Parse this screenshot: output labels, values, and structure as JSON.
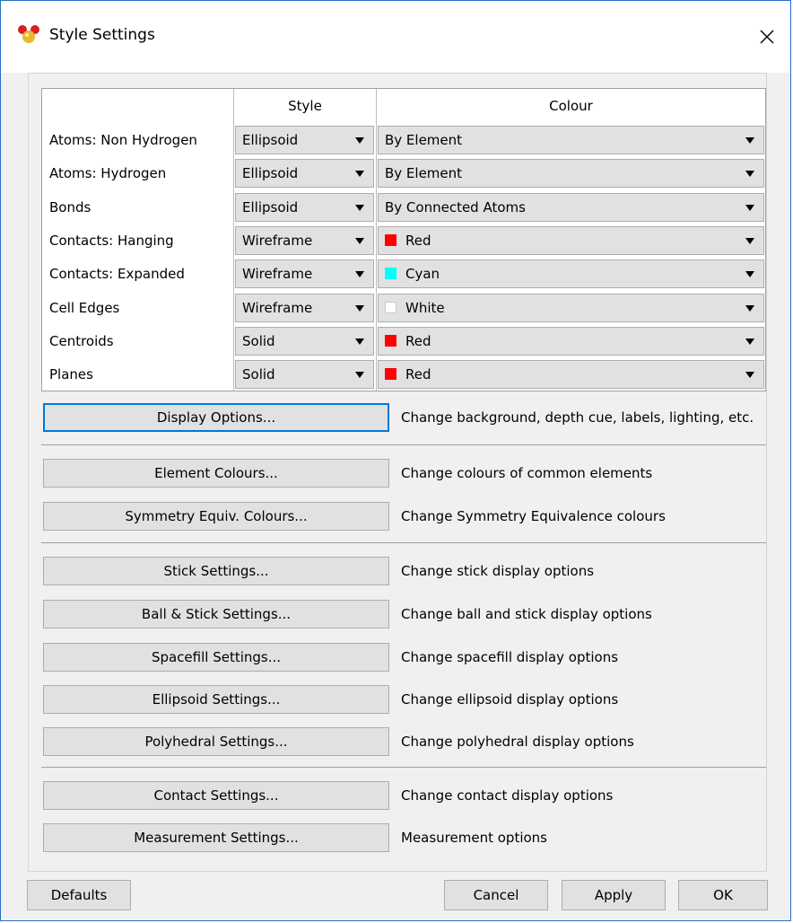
{
  "window": {
    "title": "Style Settings",
    "close_glyph": "✕",
    "icon": "molecule-app-icon"
  },
  "table": {
    "col_style": "Style",
    "col_colour": "Colour",
    "rows": [
      {
        "label": "Atoms: Non Hydrogen",
        "style": "Ellipsoid",
        "colour": "By Element",
        "swatch": null
      },
      {
        "label": "Atoms: Hydrogen",
        "style": "Ellipsoid",
        "colour": "By Element",
        "swatch": null
      },
      {
        "label": "Bonds",
        "style": "Ellipsoid",
        "colour": "By Connected Atoms",
        "swatch": null
      },
      {
        "label": "Contacts: Hanging",
        "style": "Wireframe",
        "colour": "Red",
        "swatch": "#ff0000"
      },
      {
        "label": "Contacts: Expanded",
        "style": "Wireframe",
        "colour": "Cyan",
        "swatch": "#00ffff"
      },
      {
        "label": "Cell Edges",
        "style": "Wireframe",
        "colour": "White",
        "swatch": "#ffffff"
      },
      {
        "label": "Centroids",
        "style": "Solid",
        "colour": "Red",
        "swatch": "#ff0000"
      },
      {
        "label": "Planes",
        "style": "Solid",
        "colour": "Red",
        "swatch": "#ff0000"
      }
    ]
  },
  "options": [
    {
      "button": "Display Options...",
      "desc": "Change background, depth cue, labels, lighting, etc."
    },
    {
      "button": "Element Colours...",
      "desc": "Change colours of common elements"
    },
    {
      "button": "Symmetry Equiv. Colours...",
      "desc": "Change Symmetry Equivalence colours"
    },
    {
      "button": "Stick Settings...",
      "desc": "Change stick display options"
    },
    {
      "button": "Ball & Stick Settings...",
      "desc": "Change ball and stick display options"
    },
    {
      "button": "Spacefill Settings...",
      "desc": "Change spacefill display options"
    },
    {
      "button": "Ellipsoid Settings...",
      "desc": "Change ellipsoid display options"
    },
    {
      "button": "Polyhedral Settings...",
      "desc": "Change polyhedral display options"
    },
    {
      "button": "Contact Settings...",
      "desc": "Change contact display options"
    },
    {
      "button": "Measurement Settings...",
      "desc": "Measurement options"
    }
  ],
  "footer": {
    "defaults": "Defaults",
    "cancel": "Cancel",
    "apply": "Apply",
    "ok": "OK"
  },
  "colors": {
    "focus_border": "#0078d7",
    "button_face": "#e1e1e1",
    "dialog_bg": "#f0f0f0"
  }
}
